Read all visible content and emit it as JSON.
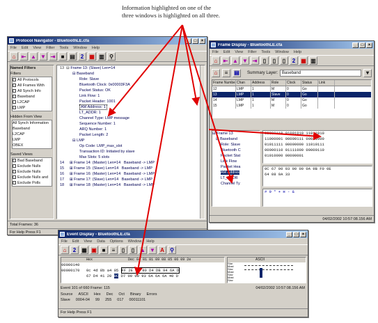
{
  "caption": {
    "line1": "Information highlighted on one of the",
    "line2": "three windows is highlighted on all three."
  },
  "colors": {
    "accent": "#0a246a",
    "arrow": "#e00000",
    "highlight": "#0a246a"
  },
  "nav_window": {
    "title": "Protocol Navigator - BluetoothLE.cfa",
    "menu": [
      "File",
      "Edit",
      "View",
      "Filter",
      "Tools",
      "Window",
      "Help"
    ],
    "panel_title": "Named Filters",
    "filters_group": "Filters",
    "filters": [
      "All Protocols",
      "All Frames With",
      "All Synch Info",
      "Baseband",
      "L2CAP",
      "LMP"
    ],
    "hidden_group": "Hidden From View",
    "hidden": [
      "All Synch Information",
      "Baseband",
      "L2CAP",
      "LMP",
      "OBEX"
    ],
    "saved_group": "Saved Views",
    "saved": [
      "Bad Baseband",
      "Exclude Nulls",
      "Exclude Nulls",
      "Exclude Nulls and",
      "Exclude Polls"
    ],
    "tree_lines": [
      "Frame 13: (Slave) Len=14",
      "Baseband",
      "Role: Slave",
      "Bluetooth Clock: 0x00003F3A",
      "Packet Status: OK",
      "Link Flow: 1",
      "Packet Header: 1001",
      "AM Address: 1",
      "LT_ADDR: 1",
      "Channel Type: LMP message",
      "Sequence Number: 1",
      "ARQ Number: 1",
      "Packet Length: 2",
      "LMP",
      "Op Code: LMP_max_slot",
      "Transaction ID: Initiated by slave",
      "Max Slots: 5 slots"
    ],
    "frame_rows": [
      {
        "num": "14",
        "text": "Frame 14: (Master) Len=14",
        "proto": "Baseband -> LMP"
      },
      {
        "num": "15",
        "text": "Frame 15: (Slave) Len=14",
        "proto": "Baseband -> LMP"
      },
      {
        "num": "16",
        "text": "Frame 16: (Master) Len=14",
        "proto": "Baseband -> LMP"
      },
      {
        "num": "17",
        "text": "Frame 17: (Slave) Len=14",
        "proto": "Baseband -> LMP"
      },
      {
        "num": "18",
        "text": "Frame 18: (Master) Len=14",
        "proto": "Baseband -> LMP"
      }
    ],
    "status_frames": "Total Frames: 36",
    "status_help": "For Help Press F1"
  },
  "frame_window": {
    "title": "Frame Display - BluetoothLE.cfa",
    "menu": [
      "File",
      "Edit",
      "View",
      "Filter",
      "Tools",
      "Window",
      "Help"
    ],
    "summary_label": "Summary Layer:",
    "summary_value": "Baseband",
    "headers": [
      "Frame Number",
      "Chan",
      "Address",
      "Role",
      "Clock",
      "Status",
      "Link"
    ],
    "rows": [
      [
        "12",
        "LMP",
        "1",
        "M",
        "0",
        "Go",
        ""
      ],
      [
        "13",
        "LMP",
        "1",
        "Slave",
        "0",
        "Go",
        ""
      ],
      [
        "14",
        "LMP",
        "1",
        "M",
        "0",
        "Go",
        ""
      ],
      [
        "15",
        "LMP",
        "1",
        "M",
        "0",
        "Go",
        ""
      ]
    ],
    "tree_items": [
      "Frame 13",
      "Baseband",
      "Role: Slave",
      "Bluetooth C",
      "Packet Stat",
      "Link Flow",
      "Packet Hea",
      "AM Addres",
      "LT_ADDR",
      "Channel Ty"
    ],
    "binary_rows": [
      "00000110 01001010 11011010",
      "11000001 00000111 00011000",
      "01011111 00000000 11010111",
      "00000110 01111000 00000110",
      "01010000 00000001"
    ],
    "hex_rows": [
      "0C 67 00 03 00 00 0A 9B F0 0E",
      "64 08 9A 33"
    ],
    "ascii_row": "# 9 * + H - &",
    "status_time": "04/02/2002 10:57:08.156 AM"
  },
  "event_window": {
    "title": "Event Display - BluetoothLE.cfa",
    "menu": [
      "File",
      "Edit",
      "View",
      "Data",
      "Options",
      "Window",
      "Help"
    ],
    "col_hex": "Hex",
    "col_ascii": "ASCII",
    "header_cells": [
      "Dec",
      "04",
      "01",
      "81",
      "09",
      "08",
      "05",
      "06",
      "09",
      "2e",
      "80",
      "Dec",
      "Bin",
      "Cl"
    ],
    "line1_addr": "00000140",
    "line1_hex": "",
    "line2_addr": "00000170",
    "line2_hex_a": "0c 4d 8b a4 05",
    "line2_hex_b": "FF 2E 00 80 D4 DB 94 6A D",
    "line3_hex_a": "67 D4 41 20",
    "line3_hex_sel": "0C",
    "line3_hex_b": "D7 00 00 93 6A 6A 6A 40 D",
    "side_labels": [
      "Star",
      "Mast",
      "Slav",
      "Mast",
      "Slav",
      "Mast",
      "Slav",
      "Mast"
    ],
    "event_line": "Event 101 of 660  Frame: 115",
    "field_row1": [
      "Source",
      "ASCII",
      "Hex",
      "Dec",
      "Oct",
      "Binary",
      "Errors"
    ],
    "field_row2": [
      "Slave",
      "0004-04",
      "99",
      "255",
      "017",
      "00011101",
      ""
    ],
    "status_time": "04/02/2002 10:57:08.156 AM",
    "status_help": "For Help Press F1"
  }
}
